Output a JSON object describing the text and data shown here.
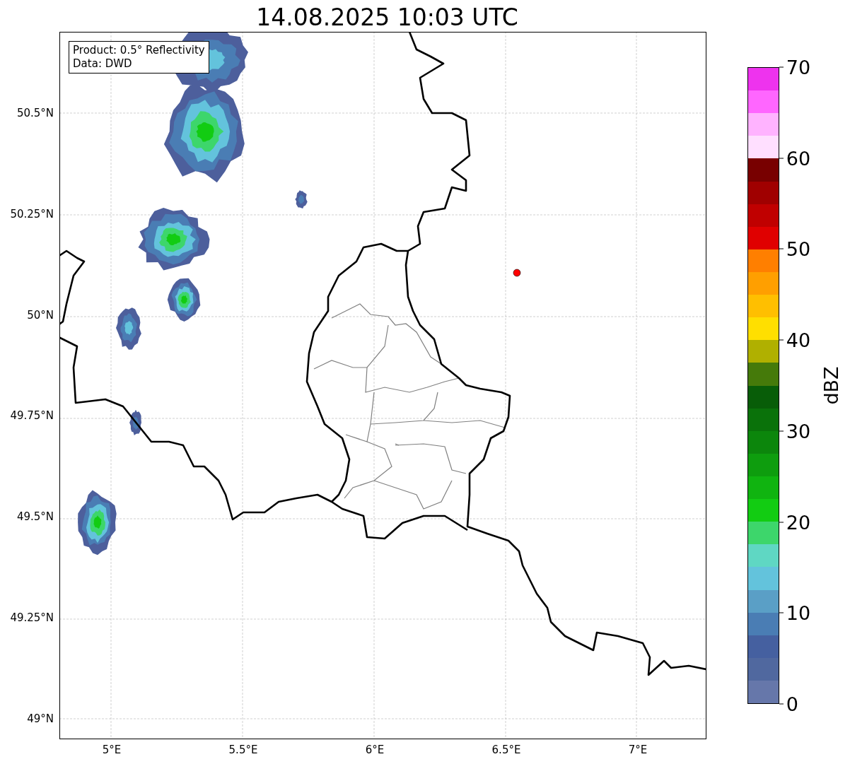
{
  "title": "14.08.2025 10:03 UTC",
  "legend": {
    "lines": [
      "Product: 0.5° Reflectivity",
      "Data: DWD"
    ]
  },
  "map": {
    "lat_labels": [
      "50.5°N",
      "50.25°N",
      "50°N",
      "49.75°N",
      "49.5°N",
      "49.25°N",
      "49°N"
    ],
    "lon_labels": [
      "5°E",
      "5.5°E",
      "6°E",
      "6.5°E",
      "7°E"
    ]
  },
  "colorbar": {
    "label": "dBZ",
    "ticks": [
      "70",
      "60",
      "50",
      "40",
      "30",
      "20",
      "10",
      "0"
    ],
    "segments": [
      {
        "color": "#ee33ee"
      },
      {
        "color": "#ff66ff"
      },
      {
        "color": "#ffb3ff"
      },
      {
        "color": "#ffdfff"
      },
      {
        "color": "#780000"
      },
      {
        "color": "#a00000"
      },
      {
        "color": "#c00000"
      },
      {
        "color": "#e00000"
      },
      {
        "color": "#ff7f00"
      },
      {
        "color": "#ff9f00"
      },
      {
        "color": "#ffbf00"
      },
      {
        "color": "#ffdf00"
      },
      {
        "color": "#b0b000"
      },
      {
        "color": "#457a0a"
      },
      {
        "color": "#085d08"
      },
      {
        "color": "#0a720a"
      },
      {
        "color": "#0c860c"
      },
      {
        "color": "#0e9d0e"
      },
      {
        "color": "#10b410"
      },
      {
        "color": "#12cc12"
      },
      {
        "color": "#3dd66b"
      },
      {
        "color": "#5fd7c3"
      },
      {
        "color": "#63c3dc"
      },
      {
        "color": "#5a9fc6"
      },
      {
        "color": "#4a7db4"
      },
      {
        "color": "#4560a0"
      },
      {
        "color": "#50689f"
      },
      {
        "color": "#6677aa"
      }
    ]
  }
}
